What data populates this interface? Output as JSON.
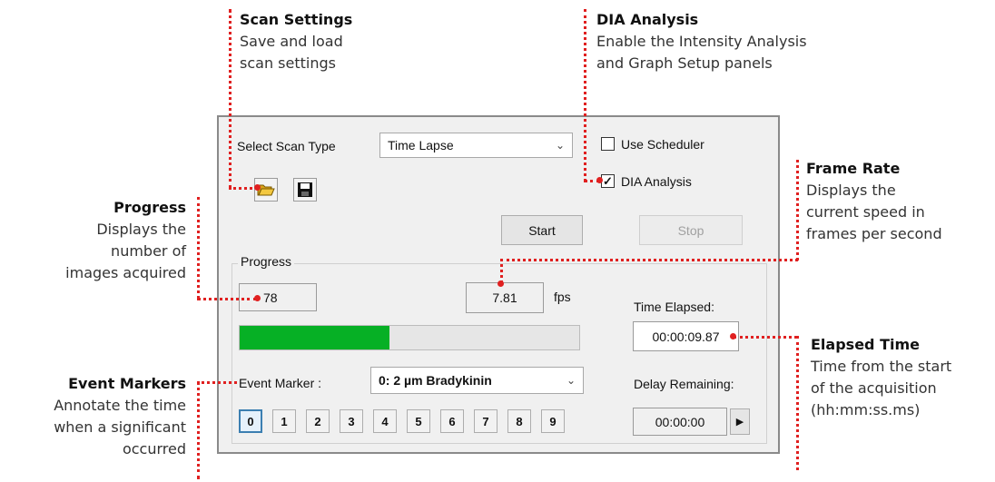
{
  "callouts": {
    "scan_settings": {
      "title": "Scan Settings",
      "desc": "Save and load\nscan settings"
    },
    "dia_analysis": {
      "title": "DIA Analysis",
      "desc": "Enable the Intensity Analysis\nand Graph Setup panels"
    },
    "frame_rate": {
      "title": "Frame Rate",
      "desc": "Displays the\ncurrent speed in\nframes per second"
    },
    "progress": {
      "title": "Progress",
      "desc": "Displays the\nnumber of\nimages acquired"
    },
    "elapsed_time": {
      "title": "Elapsed Time",
      "desc": "Time from the start\nof the acquisition\n(hh:mm:ss.ms)"
    },
    "event_markers": {
      "title": "Event Markers",
      "desc": "Annotate the time\nwhen a significant\noccurred"
    }
  },
  "panel": {
    "select_scan_type_label": "Select Scan Type",
    "scan_type_value": "Time Lapse",
    "use_scheduler_label": "Use Scheduler",
    "use_scheduler_checked": false,
    "dia_analysis_label": "DIA Analysis",
    "dia_analysis_checked": true,
    "open_icon": "folder-open-icon",
    "save_icon": "floppy-disk-icon",
    "start_label": "Start",
    "stop_label": "Stop",
    "progress_group_label": "Progress",
    "images_acquired": "78",
    "fps_value": "7.81",
    "fps_unit": "fps",
    "time_elapsed_label": "Time Elapsed:",
    "time_elapsed_value": "00:00:09.87",
    "progress_fraction": 0.44,
    "event_marker_label": "Event Marker :",
    "event_marker_value": "0: 2 µm Bradykinin",
    "delay_remaining_label": "Delay Remaining:",
    "delay_remaining_value": "00:00:00",
    "markers": [
      "0",
      "1",
      "2",
      "3",
      "4",
      "5",
      "6",
      "7",
      "8",
      "9"
    ],
    "active_marker": "0"
  },
  "colors": {
    "annotation": "#e02020",
    "progress_fill": "#06b025",
    "active_marker_border": "#3c7fb1"
  }
}
